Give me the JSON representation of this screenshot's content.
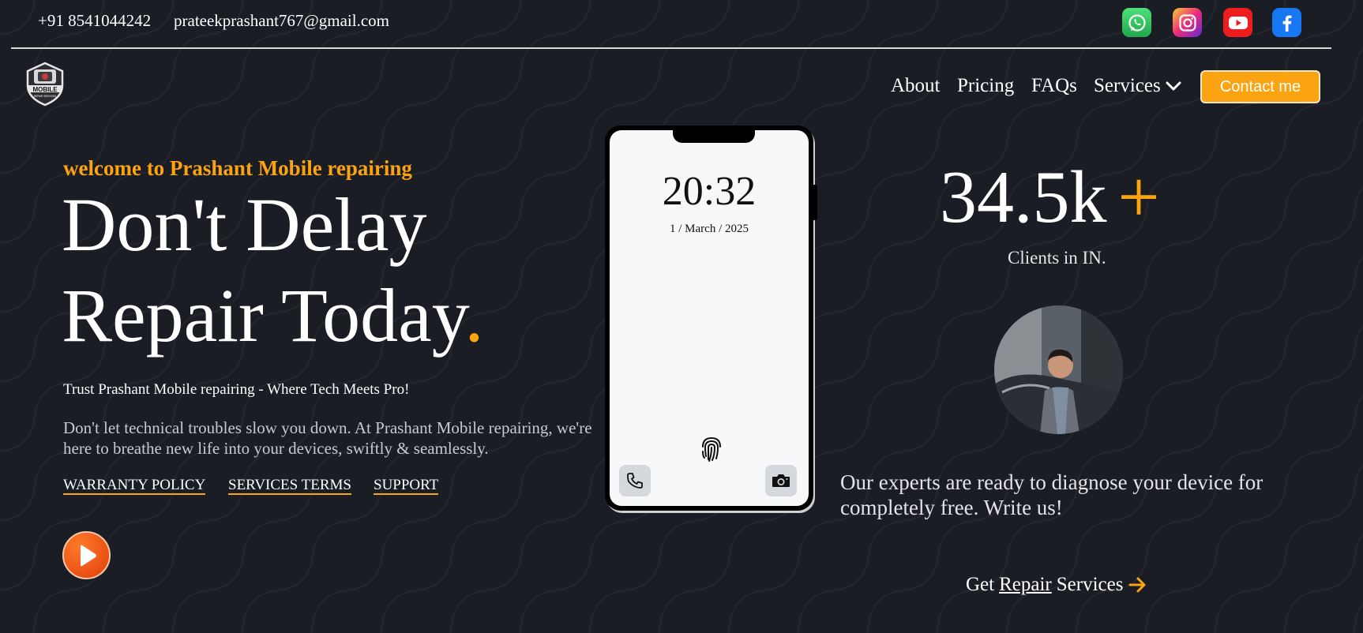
{
  "topbar": {
    "phone": "+91 8541044242",
    "email": "prateekprashant767@gmail.com",
    "social": [
      "whatsapp-icon",
      "instagram-icon",
      "youtube-icon",
      "facebook-icon"
    ]
  },
  "logo": {
    "text": "MOBILE",
    "subtext": "REPAIR SERVICES"
  },
  "nav": {
    "about": "About",
    "pricing": "Pricing",
    "faqs": "FAQs",
    "services": "Services",
    "contact": "Contact me"
  },
  "hero": {
    "welcome": "welcome to Prashant Mobile repairing",
    "headline_line1": "Don't Delay",
    "headline_line2": "Repair Today",
    "headline_dot": ".",
    "tagline": "Trust Prashant Mobile repairing - Where Tech Meets Pro!",
    "description": "Don't let technical troubles slow you down. At Prashant Mobile repairing, we're here to breathe new life into your devices, swiftly & seamlessly.",
    "links": {
      "warranty": "WARRANTY POLICY",
      "terms": "SERVICES TERMS",
      "support": "SUPPORT"
    }
  },
  "phone_mockup": {
    "time": "20:32",
    "date": "1 / March / 2025"
  },
  "stats": {
    "value": "34.5k",
    "plus": "+",
    "label": "Clients in IN."
  },
  "experts": {
    "text": "Our experts are ready to diagnose your device for completely free. Write us!"
  },
  "cta": {
    "prefix": "Get",
    "underlined": "Repair",
    "suffix": "Services"
  },
  "colors": {
    "background": "#1b1d24",
    "accent": "#fca311",
    "text": "#ffffff"
  }
}
